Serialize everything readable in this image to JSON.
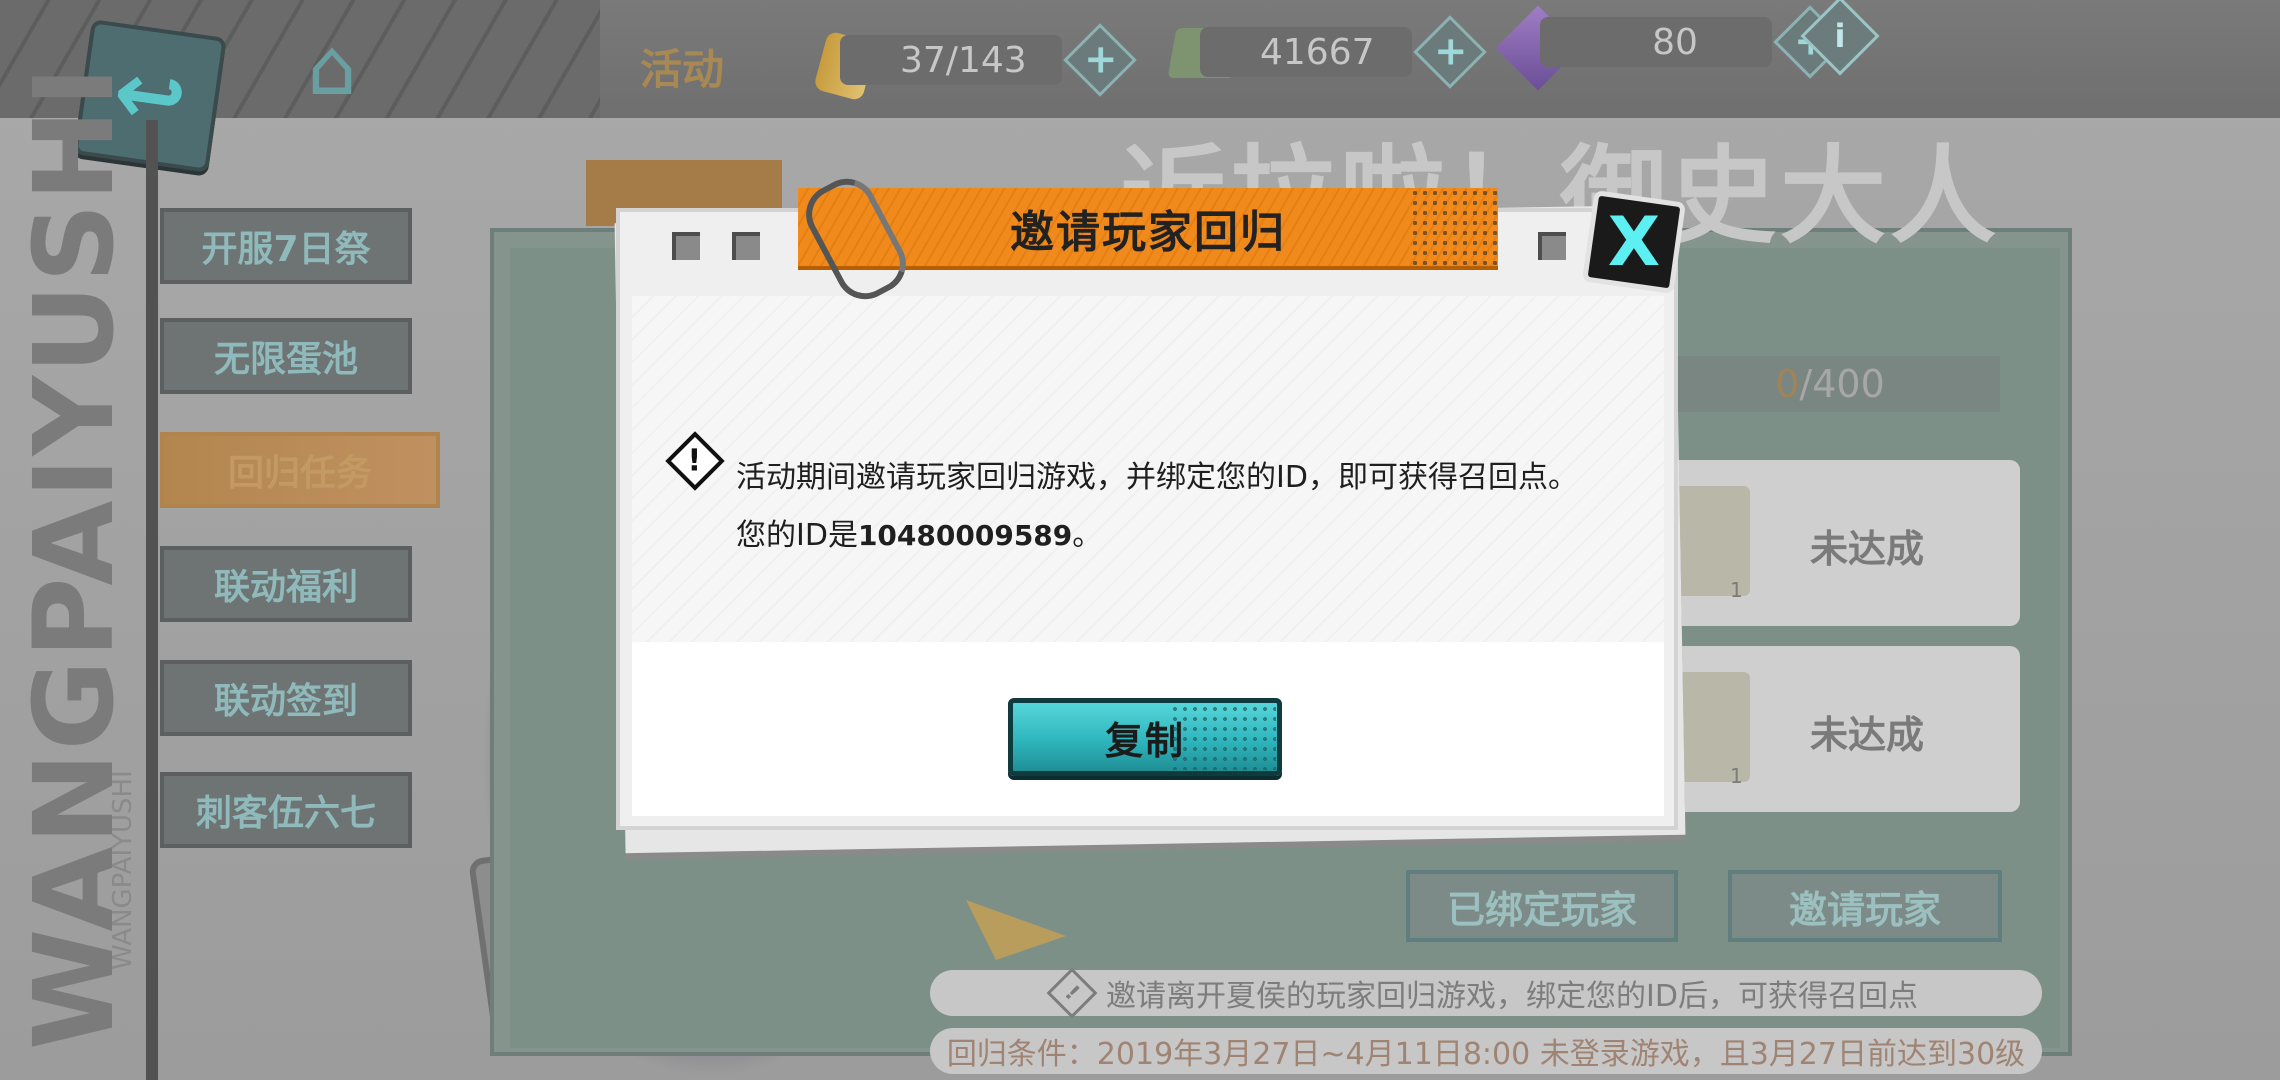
{
  "header": {
    "title": "活动",
    "stamina": "37/143",
    "money": "41667",
    "gems": "80",
    "plus_symbol": "+",
    "info_symbol": "i"
  },
  "sidebar": {
    "watermark": "WANGPAIYUSHI",
    "watermark_small": "WANGPAIYUSHI",
    "items": [
      {
        "label": "开服7日祭",
        "active": false
      },
      {
        "label": "无限蛋池",
        "active": false
      },
      {
        "label": "回归任务",
        "active": true
      },
      {
        "label": "联动福利",
        "active": false
      },
      {
        "label": "联动签到",
        "active": false
      },
      {
        "label": "刺客伍六七",
        "active": false
      }
    ]
  },
  "panel": {
    "banner": "近拉啦！御史大人",
    "progress_current": "0",
    "progress_total": "/400",
    "rewards": [
      {
        "status": "未达成",
        "qty": "1"
      },
      {
        "status": "未达成",
        "qty": "1"
      }
    ],
    "bound_players_button": "已绑定玩家",
    "invite_players_button": "邀请玩家",
    "note_invite": "邀请离开夏侯的玩家回归游戏，绑定您的ID后，可获得召回点",
    "note_condition": "回归条件：2019年3月27日~4月11日8:00 未登录游戏，且3月27日前达到30级"
  },
  "dialog": {
    "title": "邀请玩家回归",
    "close_symbol": "X",
    "warning_symbol": "!",
    "message_line1": "活动期间邀请玩家回归游戏，并绑定您的ID，即可获得召回点。",
    "message_line2_prefix": "您的ID是",
    "player_id": "10480009589",
    "message_line2_suffix": "。",
    "copy_button": "复制"
  },
  "colors": {
    "accent_orange": "#f08a1c",
    "accent_cyan": "#3cc6cb",
    "close_cyan": "#5cf0f2"
  }
}
